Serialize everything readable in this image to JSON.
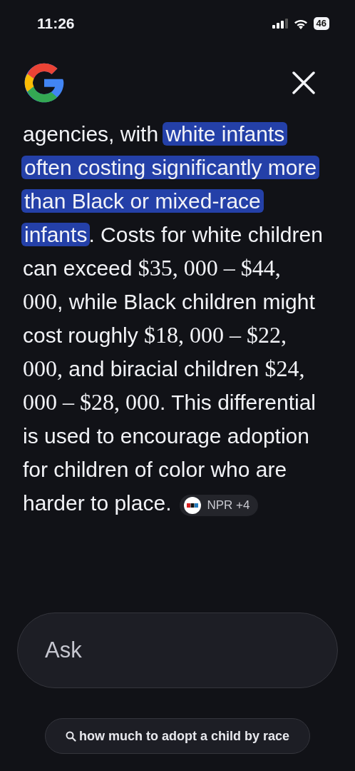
{
  "status_bar": {
    "time": "11:26",
    "battery": "46"
  },
  "answer": {
    "segments": [
      {
        "kind": "text",
        "text": "agencies, with "
      },
      {
        "kind": "highlight",
        "text": "white infants often costing significantly more than Black or mixed-race infants"
      },
      {
        "kind": "text",
        "text": ". Costs for white children can exceed "
      },
      {
        "kind": "math",
        "text": "$35, 000 – $44, 000"
      },
      {
        "kind": "text",
        "text": ", while Black children might cost roughly "
      },
      {
        "kind": "math",
        "text": "$18, 000 – $22, 000,"
      },
      {
        "kind": "text",
        "text": " and biracial children "
      },
      {
        "kind": "math",
        "text": "$24, 000 – $28, 000"
      },
      {
        "kind": "text",
        "text": ". This differential is used to encourage adoption for children of color who are harder to place."
      }
    ],
    "source_chip": "NPR +4"
  },
  "ask_field": {
    "placeholder": "Ask"
  },
  "suggestion": "how much to adopt a child by race"
}
